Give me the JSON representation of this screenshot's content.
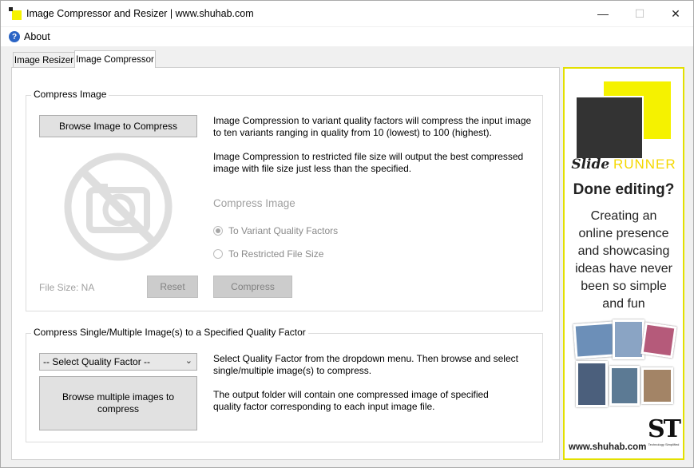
{
  "window": {
    "title": "Image Compressor and Resizer | www.shuhab.com",
    "minimize": "—",
    "maximize": "☐",
    "close": "✕"
  },
  "menu": {
    "about": "About"
  },
  "tabs": [
    {
      "label": "Image Resizer",
      "active": false
    },
    {
      "label": "Image Compressor",
      "active": true
    }
  ],
  "compress_image": {
    "group_title": "Compress Image",
    "browse_button": "Browse Image to Compress",
    "desc1": "Image Compression to variant quality factors will compress the input image to ten variants ranging in quality from 10 (lowest) to 100 (highest).",
    "desc2": "Image Compression to restricted file size will output the best compressed image with file size just less than the specified.",
    "options_title": "Compress Image",
    "option_variant": "To Variant Quality Factors",
    "option_restricted": "To Restricted File Size",
    "selected_option": "variant",
    "file_size": "File Size: NA",
    "reset_button": "Reset",
    "compress_button": "Compress"
  },
  "compress_multiple": {
    "group_title": "Compress Single/Multiple Image(s) to a Specified Quality Factor",
    "select_value": "-- Select Quality Factor --",
    "browse_button": "Browse multiple images to compress",
    "desc1": "Select Quality Factor from the dropdown menu. Then browse and select single/multiple image(s) to compress.",
    "desc2": "The output folder will contain one compressed image of specified quality factor corresponding to each input image file."
  },
  "ad": {
    "brand_slide": "Slide",
    "brand_runner": "RUNNER",
    "headline": "Done editing?",
    "body": "Creating an online presence and showcasing ideas have never been so simple and fun",
    "url": "www.shuhab.com",
    "logo": "ST",
    "logo_tagline": "Technology Simplified"
  },
  "colors": {
    "accent_yellow": "#f5f200",
    "dark_square": "#333333",
    "disabled_gray": "#a0a0a0"
  }
}
